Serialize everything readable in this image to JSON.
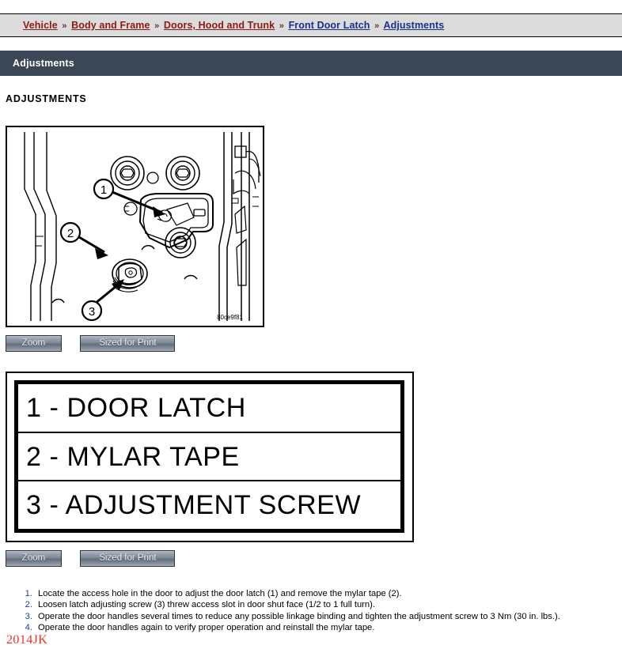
{
  "breadcrumb": {
    "separator": "»",
    "items": [
      {
        "label": "Vehicle",
        "color": "red"
      },
      {
        "label": "Body and Frame",
        "color": "red"
      },
      {
        "label": "Doors, Hood and Trunk",
        "color": "red"
      },
      {
        "label": "Front Door Latch",
        "color": "blue"
      },
      {
        "label": "Adjustments",
        "color": "blue"
      }
    ]
  },
  "section_header": {
    "title": "Adjustments",
    "background": "#3b4757",
    "text_color": "#ffffff"
  },
  "page_heading": "ADJUSTMENTS",
  "figure": {
    "caption_code": "80ce9f81",
    "callouts": [
      "1",
      "2",
      "3"
    ],
    "alt": "Front door latch access hole line drawing"
  },
  "buttons_top": {
    "zoom_label": "Zoom",
    "print_label": "Sized for Print"
  },
  "buttons_bottom": {
    "zoom_label": "Zoom",
    "print_label": "Sized for Print"
  },
  "legend": {
    "rows": [
      "1 - DOOR LATCH",
      "2 - MYLAR TAPE",
      "3 - ADJUSTMENT SCREW"
    ]
  },
  "instructions": {
    "items": [
      {
        "num": "1.",
        "text": "Locate the access hole in the door to adjust the door latch (1) and remove the mylar tape (2)."
      },
      {
        "num": "2.",
        "text": "Loosen latch adjusting screw (3) threw access slot in door shut face (1/2 to 1 full turn)."
      },
      {
        "num": "3.",
        "text": "Operate the door handles several times to reduce any possible linkage binding and tighten the adjustment screw to 3 Nm (30 in. lbs.)."
      },
      {
        "num": "4.",
        "text": "Operate the door handles again to verify proper operation and reinstall the mylar tape."
      }
    ],
    "number_color": "#1c3f94"
  },
  "watermark": {
    "text": "2014JK",
    "color": "#e8352b"
  }
}
